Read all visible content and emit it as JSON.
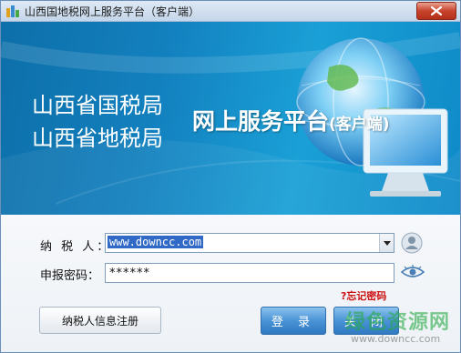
{
  "window": {
    "title": "山西国地税网上服务平台（客户端）",
    "close_icon": "close-icon"
  },
  "banner": {
    "line1": "山西省国税局",
    "line2": "山西省地税局",
    "platform": "网上服务平台",
    "platform_suffix": "(客户端)"
  },
  "form": {
    "taxpayer_label": "纳 税 人：",
    "taxpayer_value": "www.downcc.com",
    "password_label": "申报密码：",
    "password_value": "******",
    "forgot_link": "?忘记密码"
  },
  "buttons": {
    "register": "纳税人信息注册",
    "login": "登 录",
    "close": "关 闭"
  },
  "watermark": {
    "text": "绿色资源网",
    "url": "www.downcc.com"
  },
  "colors": {
    "banner_blue": "#1381bf",
    "button_blue": "#4a93d6",
    "forgot_red": "#cc1111",
    "watermark_green": "#28aa46"
  }
}
